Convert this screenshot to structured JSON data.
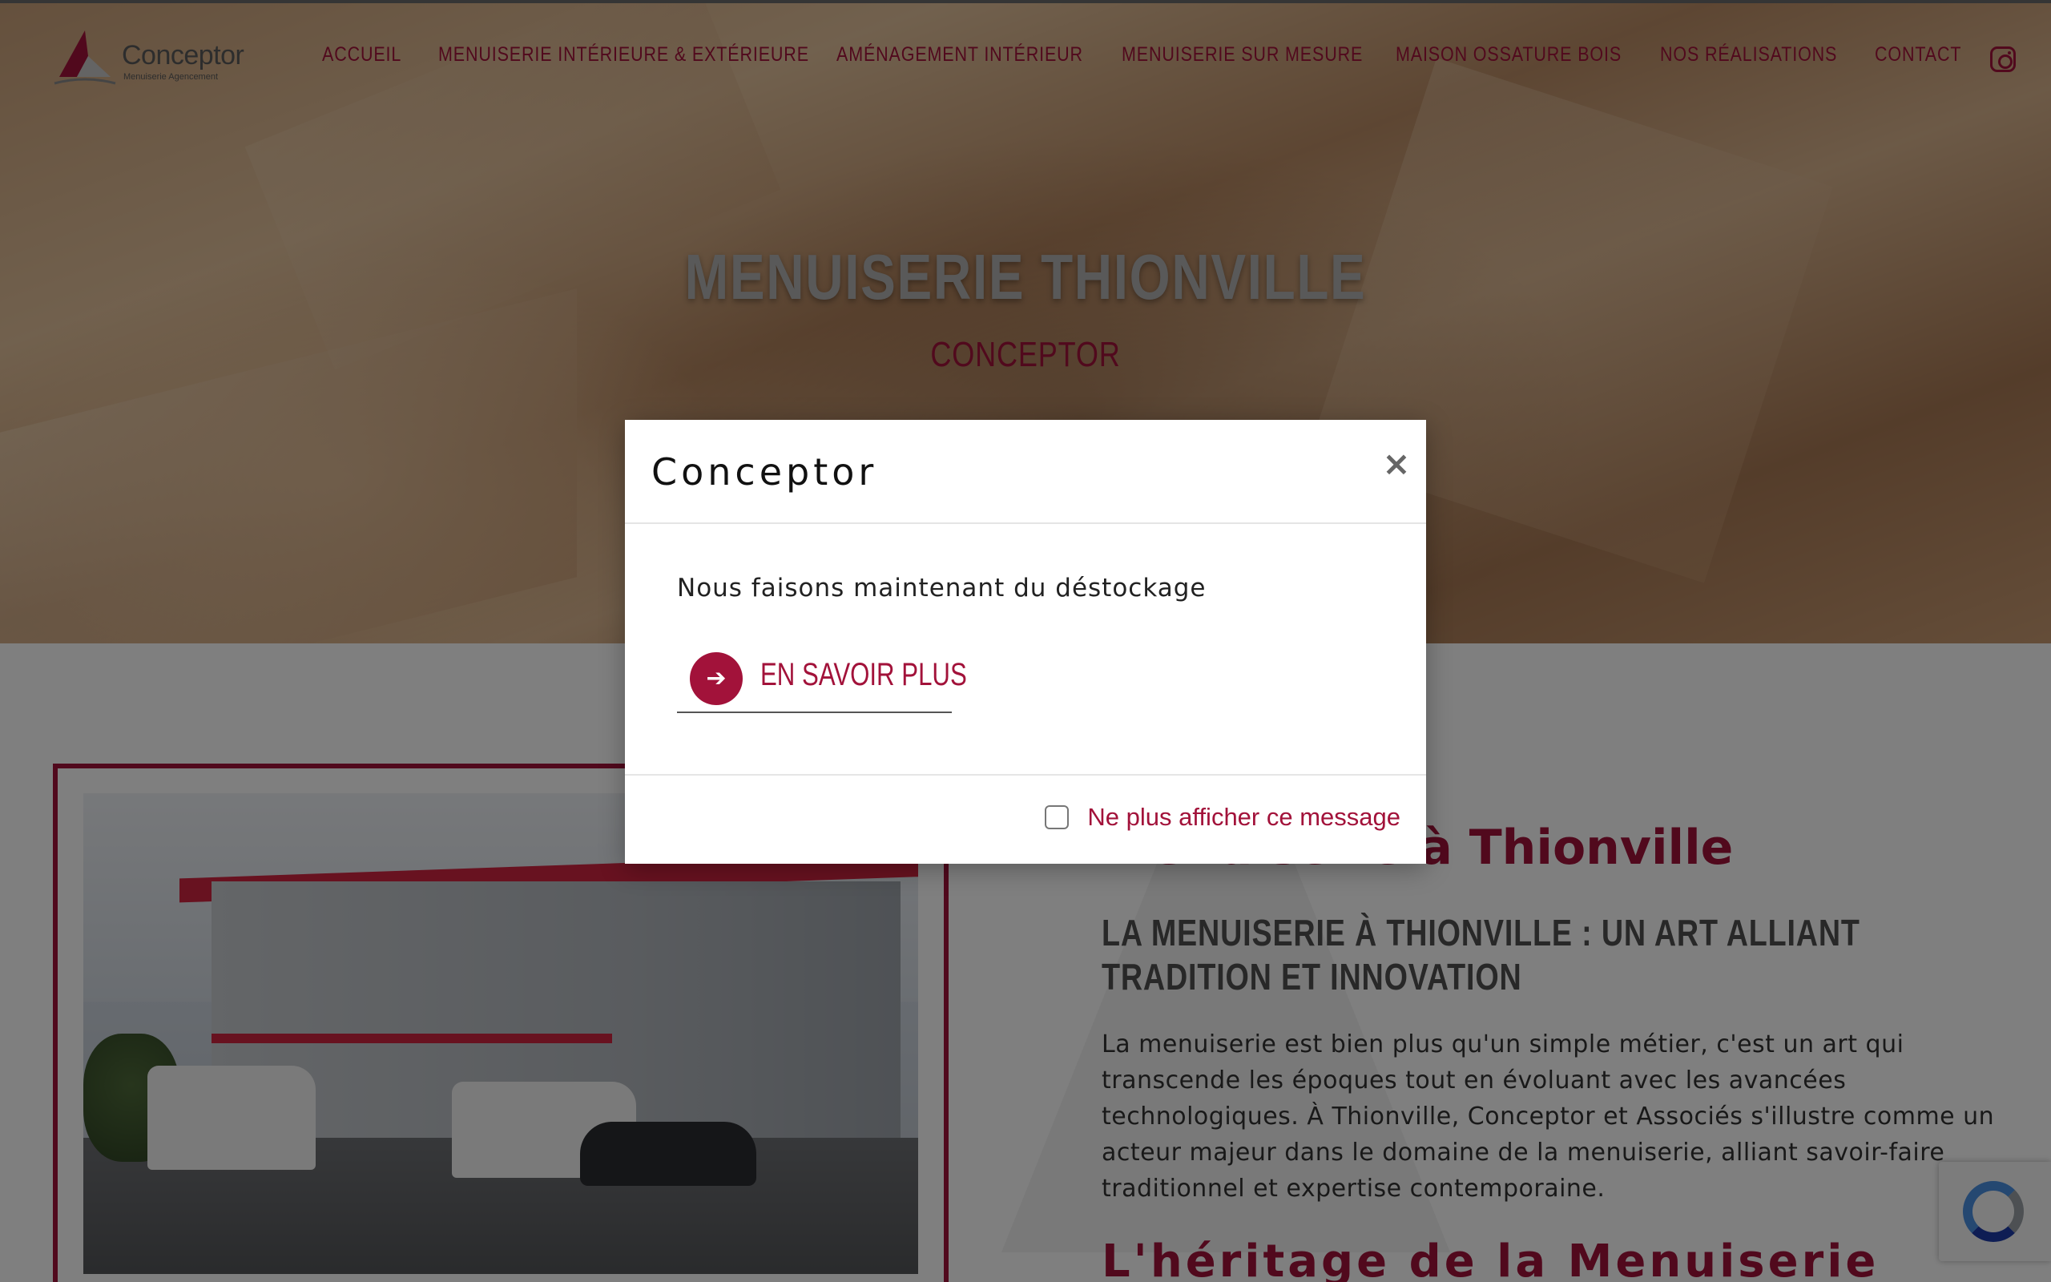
{
  "brand": {
    "name": "Conceptor",
    "tagline": "Menuiserie Agencement",
    "accent_color": "#a2123a"
  },
  "nav": {
    "items": [
      {
        "label": "ACCUEIL"
      },
      {
        "label": "MENUISERIE INTÉRIEURE & EXTÉRIEURE"
      },
      {
        "label": "AMÉNAGEMENT INTÉRIEUR"
      },
      {
        "label": "MENUISERIE SUR MESURE"
      },
      {
        "label": "MAISON OSSATURE BOIS"
      },
      {
        "label": "NOS RÉALISATIONS"
      },
      {
        "label": "CONTACT"
      }
    ],
    "social_icon": "instagram-icon"
  },
  "hero": {
    "title": "MENUISERIE THIONVILLE",
    "subtitle": "CONCEPTOR"
  },
  "section": {
    "heading": "menuiserie à Thionville",
    "subheading": "LA MENUISERIE À THIONVILLE : UN ART ALLIANT TRADITION ET INNOVATION",
    "paragraph": "La menuiserie est bien plus qu'un simple métier, c'est un art qui transcende les époques tout en évoluant avec les avancées technologiques. À Thionville, Conceptor et Associés s'illustre comme un acteur majeur dans le domaine de la menuiserie, alliant savoir-faire traditionnel et expertise contemporaine.",
    "heading2": "L'héritage de la Menuiserie"
  },
  "modal": {
    "title": "Conceptor",
    "close_glyph": "×",
    "message": "Nous faisons maintenant du déstockage",
    "link_label": "EN SAVOIR PLUS",
    "link_icon": "arrow-right-icon",
    "link_glyph": "➔",
    "checkbox_label": "Ne plus afficher ce message",
    "checkbox_checked": false
  }
}
